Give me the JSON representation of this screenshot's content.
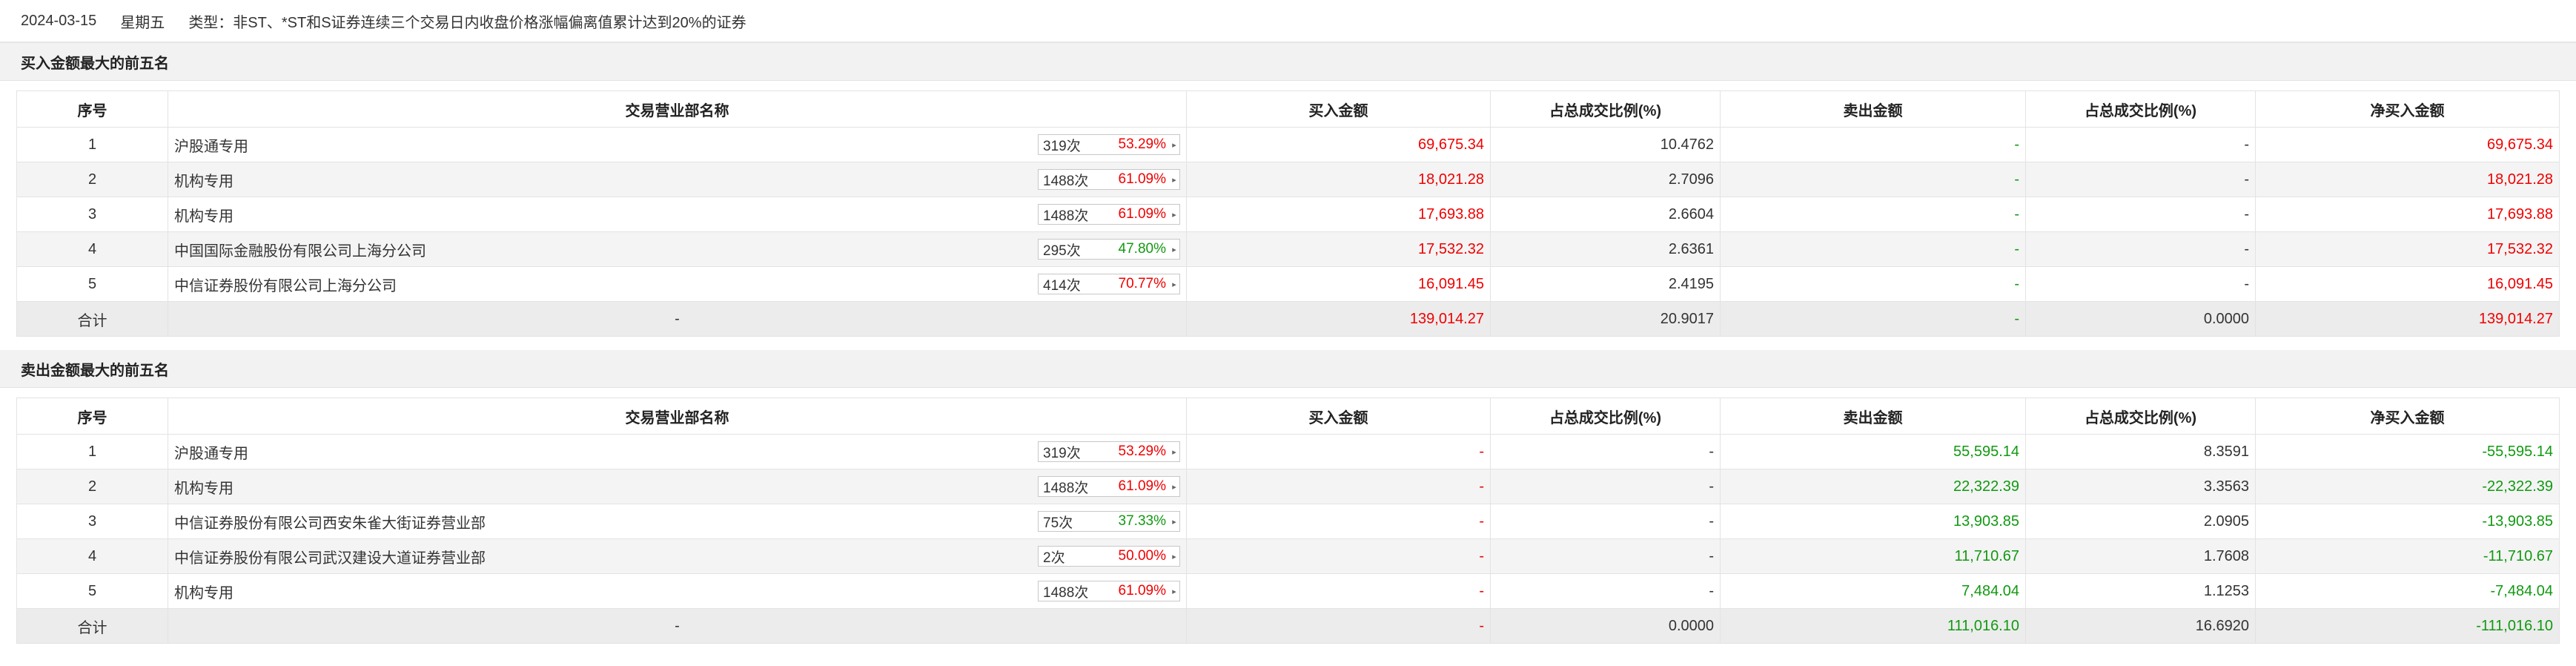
{
  "header": {
    "date": "2024-03-15",
    "weekday": "星期五",
    "type_label": "类型：非ST、*ST和S证券连续三个交易日内收盘价格涨幅偏离值累计达到20%的证券"
  },
  "columns": {
    "seq": "序号",
    "dept": "交易营业部名称",
    "buy_amt": "买入金额",
    "buy_ratio": "占总成交比例(%)",
    "sell_amt": "卖出金额",
    "sell_ratio": "占总成交比例(%)",
    "net": "净买入金额"
  },
  "buy_top": {
    "title": "买入金额最大的前五名",
    "rows": [
      {
        "seq": "1",
        "name": "沪股通专用",
        "times": "319次",
        "rate": "53.29%",
        "buy": "69,675.34",
        "buy_ratio": "10.4762",
        "sell": "-",
        "sell_ratio": "-",
        "net": "69,675.34"
      },
      {
        "seq": "2",
        "name": "机构专用",
        "times": "1488次",
        "rate": "61.09%",
        "buy": "18,021.28",
        "buy_ratio": "2.7096",
        "sell": "-",
        "sell_ratio": "-",
        "net": "18,021.28"
      },
      {
        "seq": "3",
        "name": "机构专用",
        "times": "1488次",
        "rate": "61.09%",
        "buy": "17,693.88",
        "buy_ratio": "2.6604",
        "sell": "-",
        "sell_ratio": "-",
        "net": "17,693.88"
      },
      {
        "seq": "4",
        "name": "中国国际金融股份有限公司上海分公司",
        "times": "295次",
        "rate": "47.80%",
        "buy": "17,532.32",
        "buy_ratio": "2.6361",
        "sell": "-",
        "sell_ratio": "-",
        "net": "17,532.32"
      },
      {
        "seq": "5",
        "name": "中信证券股份有限公司上海分公司",
        "times": "414次",
        "rate": "70.77%",
        "buy": "16,091.45",
        "buy_ratio": "2.4195",
        "sell": "-",
        "sell_ratio": "-",
        "net": "16,091.45"
      }
    ],
    "total": {
      "label": "合计",
      "name": "-",
      "buy": "139,014.27",
      "buy_ratio": "20.9017",
      "sell": "-",
      "sell_ratio": "0.0000",
      "net": "139,014.27"
    }
  },
  "sell_top": {
    "title": "卖出金额最大的前五名",
    "rows": [
      {
        "seq": "1",
        "name": "沪股通专用",
        "times": "319次",
        "rate": "53.29%",
        "buy": "-",
        "buy_ratio": "-",
        "sell": "55,595.14",
        "sell_ratio": "8.3591",
        "net": "-55,595.14"
      },
      {
        "seq": "2",
        "name": "机构专用",
        "times": "1488次",
        "rate": "61.09%",
        "buy": "-",
        "buy_ratio": "-",
        "sell": "22,322.39",
        "sell_ratio": "3.3563",
        "net": "-22,322.39"
      },
      {
        "seq": "3",
        "name": "中信证券股份有限公司西安朱雀大街证券营业部",
        "times": "75次",
        "rate": "37.33%",
        "buy": "-",
        "buy_ratio": "-",
        "sell": "13,903.85",
        "sell_ratio": "2.0905",
        "net": "-13,903.85"
      },
      {
        "seq": "4",
        "name": "中信证券股份有限公司武汉建设大道证券营业部",
        "times": "2次",
        "rate": "50.00%",
        "buy": "-",
        "buy_ratio": "-",
        "sell": "11,710.67",
        "sell_ratio": "1.7608",
        "net": "-11,710.67"
      },
      {
        "seq": "5",
        "name": "机构专用",
        "times": "1488次",
        "rate": "61.09%",
        "buy": "-",
        "buy_ratio": "-",
        "sell": "7,484.04",
        "sell_ratio": "1.1253",
        "net": "-7,484.04"
      }
    ],
    "total": {
      "label": "合计",
      "name": "-",
      "buy": "-",
      "buy_ratio": "0.0000",
      "sell": "111,016.10",
      "sell_ratio": "16.6920",
      "net": "-111,016.10"
    }
  },
  "colors": {
    "up": "#f00000",
    "down": "#119911"
  }
}
